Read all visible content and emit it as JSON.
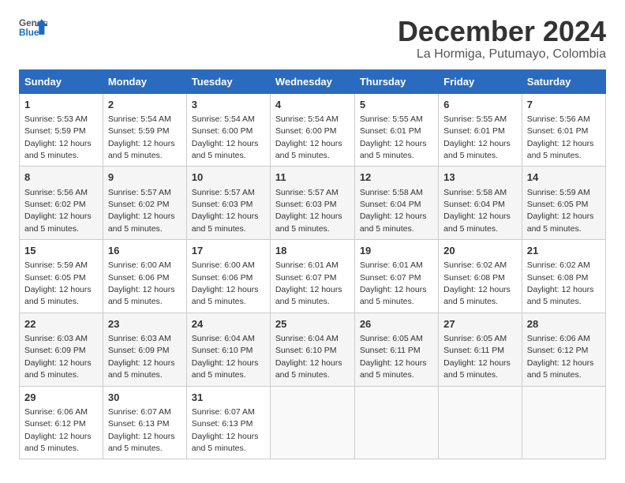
{
  "header": {
    "logo_general": "General",
    "logo_blue": "Blue",
    "month_title": "December 2024",
    "location": "La Hormiga, Putumayo, Colombia"
  },
  "days_of_week": [
    "Sunday",
    "Monday",
    "Tuesday",
    "Wednesday",
    "Thursday",
    "Friday",
    "Saturday"
  ],
  "weeks": [
    [
      {
        "day": 1,
        "sunrise": "5:53 AM",
        "sunset": "5:59 PM",
        "daylight": "12 hours and 5 minutes."
      },
      {
        "day": 2,
        "sunrise": "5:54 AM",
        "sunset": "5:59 PM",
        "daylight": "12 hours and 5 minutes."
      },
      {
        "day": 3,
        "sunrise": "5:54 AM",
        "sunset": "6:00 PM",
        "daylight": "12 hours and 5 minutes."
      },
      {
        "day": 4,
        "sunrise": "5:54 AM",
        "sunset": "6:00 PM",
        "daylight": "12 hours and 5 minutes."
      },
      {
        "day": 5,
        "sunrise": "5:55 AM",
        "sunset": "6:01 PM",
        "daylight": "12 hours and 5 minutes."
      },
      {
        "day": 6,
        "sunrise": "5:55 AM",
        "sunset": "6:01 PM",
        "daylight": "12 hours and 5 minutes."
      },
      {
        "day": 7,
        "sunrise": "5:56 AM",
        "sunset": "6:01 PM",
        "daylight": "12 hours and 5 minutes."
      }
    ],
    [
      {
        "day": 8,
        "sunrise": "5:56 AM",
        "sunset": "6:02 PM",
        "daylight": "12 hours and 5 minutes."
      },
      {
        "day": 9,
        "sunrise": "5:57 AM",
        "sunset": "6:02 PM",
        "daylight": "12 hours and 5 minutes."
      },
      {
        "day": 10,
        "sunrise": "5:57 AM",
        "sunset": "6:03 PM",
        "daylight": "12 hours and 5 minutes."
      },
      {
        "day": 11,
        "sunrise": "5:57 AM",
        "sunset": "6:03 PM",
        "daylight": "12 hours and 5 minutes."
      },
      {
        "day": 12,
        "sunrise": "5:58 AM",
        "sunset": "6:04 PM",
        "daylight": "12 hours and 5 minutes."
      },
      {
        "day": 13,
        "sunrise": "5:58 AM",
        "sunset": "6:04 PM",
        "daylight": "12 hours and 5 minutes."
      },
      {
        "day": 14,
        "sunrise": "5:59 AM",
        "sunset": "6:05 PM",
        "daylight": "12 hours and 5 minutes."
      }
    ],
    [
      {
        "day": 15,
        "sunrise": "5:59 AM",
        "sunset": "6:05 PM",
        "daylight": "12 hours and 5 minutes."
      },
      {
        "day": 16,
        "sunrise": "6:00 AM",
        "sunset": "6:06 PM",
        "daylight": "12 hours and 5 minutes."
      },
      {
        "day": 17,
        "sunrise": "6:00 AM",
        "sunset": "6:06 PM",
        "daylight": "12 hours and 5 minutes."
      },
      {
        "day": 18,
        "sunrise": "6:01 AM",
        "sunset": "6:07 PM",
        "daylight": "12 hours and 5 minutes."
      },
      {
        "day": 19,
        "sunrise": "6:01 AM",
        "sunset": "6:07 PM",
        "daylight": "12 hours and 5 minutes."
      },
      {
        "day": 20,
        "sunrise": "6:02 AM",
        "sunset": "6:08 PM",
        "daylight": "12 hours and 5 minutes."
      },
      {
        "day": 21,
        "sunrise": "6:02 AM",
        "sunset": "6:08 PM",
        "daylight": "12 hours and 5 minutes."
      }
    ],
    [
      {
        "day": 22,
        "sunrise": "6:03 AM",
        "sunset": "6:09 PM",
        "daylight": "12 hours and 5 minutes."
      },
      {
        "day": 23,
        "sunrise": "6:03 AM",
        "sunset": "6:09 PM",
        "daylight": "12 hours and 5 minutes."
      },
      {
        "day": 24,
        "sunrise": "6:04 AM",
        "sunset": "6:10 PM",
        "daylight": "12 hours and 5 minutes."
      },
      {
        "day": 25,
        "sunrise": "6:04 AM",
        "sunset": "6:10 PM",
        "daylight": "12 hours and 5 minutes."
      },
      {
        "day": 26,
        "sunrise": "6:05 AM",
        "sunset": "6:11 PM",
        "daylight": "12 hours and 5 minutes."
      },
      {
        "day": 27,
        "sunrise": "6:05 AM",
        "sunset": "6:11 PM",
        "daylight": "12 hours and 5 minutes."
      },
      {
        "day": 28,
        "sunrise": "6:06 AM",
        "sunset": "6:12 PM",
        "daylight": "12 hours and 5 minutes."
      }
    ],
    [
      {
        "day": 29,
        "sunrise": "6:06 AM",
        "sunset": "6:12 PM",
        "daylight": "12 hours and 5 minutes."
      },
      {
        "day": 30,
        "sunrise": "6:07 AM",
        "sunset": "6:13 PM",
        "daylight": "12 hours and 5 minutes."
      },
      {
        "day": 31,
        "sunrise": "6:07 AM",
        "sunset": "6:13 PM",
        "daylight": "12 hours and 5 minutes."
      },
      null,
      null,
      null,
      null
    ]
  ]
}
